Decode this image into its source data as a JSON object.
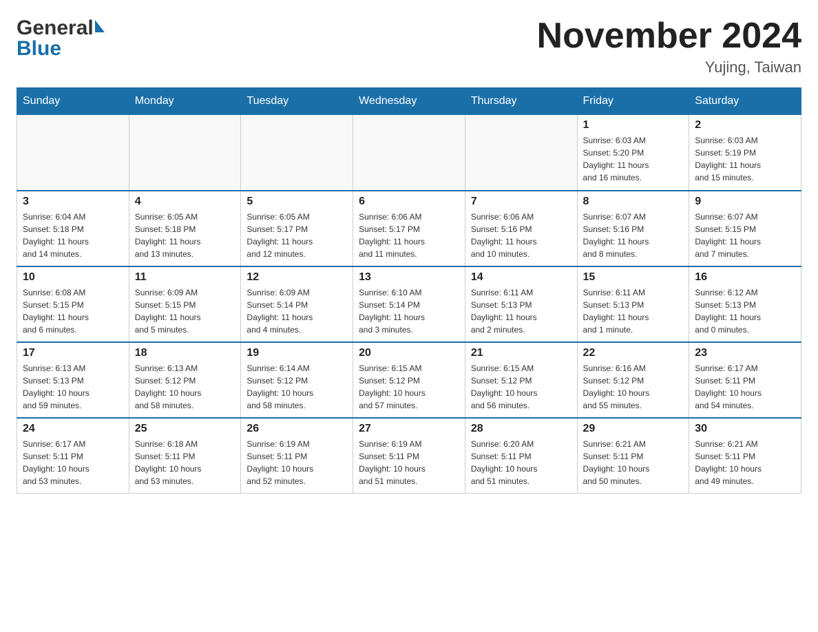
{
  "header": {
    "logo_general": "General",
    "logo_blue": "Blue",
    "month_title": "November 2024",
    "location": "Yujing, Taiwan"
  },
  "weekdays": [
    "Sunday",
    "Monday",
    "Tuesday",
    "Wednesday",
    "Thursday",
    "Friday",
    "Saturday"
  ],
  "rows": [
    [
      {
        "day": "",
        "info": ""
      },
      {
        "day": "",
        "info": ""
      },
      {
        "day": "",
        "info": ""
      },
      {
        "day": "",
        "info": ""
      },
      {
        "day": "",
        "info": ""
      },
      {
        "day": "1",
        "info": "Sunrise: 6:03 AM\nSunset: 5:20 PM\nDaylight: 11 hours\nand 16 minutes."
      },
      {
        "day": "2",
        "info": "Sunrise: 6:03 AM\nSunset: 5:19 PM\nDaylight: 11 hours\nand 15 minutes."
      }
    ],
    [
      {
        "day": "3",
        "info": "Sunrise: 6:04 AM\nSunset: 5:18 PM\nDaylight: 11 hours\nand 14 minutes."
      },
      {
        "day": "4",
        "info": "Sunrise: 6:05 AM\nSunset: 5:18 PM\nDaylight: 11 hours\nand 13 minutes."
      },
      {
        "day": "5",
        "info": "Sunrise: 6:05 AM\nSunset: 5:17 PM\nDaylight: 11 hours\nand 12 minutes."
      },
      {
        "day": "6",
        "info": "Sunrise: 6:06 AM\nSunset: 5:17 PM\nDaylight: 11 hours\nand 11 minutes."
      },
      {
        "day": "7",
        "info": "Sunrise: 6:06 AM\nSunset: 5:16 PM\nDaylight: 11 hours\nand 10 minutes."
      },
      {
        "day": "8",
        "info": "Sunrise: 6:07 AM\nSunset: 5:16 PM\nDaylight: 11 hours\nand 8 minutes."
      },
      {
        "day": "9",
        "info": "Sunrise: 6:07 AM\nSunset: 5:15 PM\nDaylight: 11 hours\nand 7 minutes."
      }
    ],
    [
      {
        "day": "10",
        "info": "Sunrise: 6:08 AM\nSunset: 5:15 PM\nDaylight: 11 hours\nand 6 minutes."
      },
      {
        "day": "11",
        "info": "Sunrise: 6:09 AM\nSunset: 5:15 PM\nDaylight: 11 hours\nand 5 minutes."
      },
      {
        "day": "12",
        "info": "Sunrise: 6:09 AM\nSunset: 5:14 PM\nDaylight: 11 hours\nand 4 minutes."
      },
      {
        "day": "13",
        "info": "Sunrise: 6:10 AM\nSunset: 5:14 PM\nDaylight: 11 hours\nand 3 minutes."
      },
      {
        "day": "14",
        "info": "Sunrise: 6:11 AM\nSunset: 5:13 PM\nDaylight: 11 hours\nand 2 minutes."
      },
      {
        "day": "15",
        "info": "Sunrise: 6:11 AM\nSunset: 5:13 PM\nDaylight: 11 hours\nand 1 minute."
      },
      {
        "day": "16",
        "info": "Sunrise: 6:12 AM\nSunset: 5:13 PM\nDaylight: 11 hours\nand 0 minutes."
      }
    ],
    [
      {
        "day": "17",
        "info": "Sunrise: 6:13 AM\nSunset: 5:13 PM\nDaylight: 10 hours\nand 59 minutes."
      },
      {
        "day": "18",
        "info": "Sunrise: 6:13 AM\nSunset: 5:12 PM\nDaylight: 10 hours\nand 58 minutes."
      },
      {
        "day": "19",
        "info": "Sunrise: 6:14 AM\nSunset: 5:12 PM\nDaylight: 10 hours\nand 58 minutes."
      },
      {
        "day": "20",
        "info": "Sunrise: 6:15 AM\nSunset: 5:12 PM\nDaylight: 10 hours\nand 57 minutes."
      },
      {
        "day": "21",
        "info": "Sunrise: 6:15 AM\nSunset: 5:12 PM\nDaylight: 10 hours\nand 56 minutes."
      },
      {
        "day": "22",
        "info": "Sunrise: 6:16 AM\nSunset: 5:12 PM\nDaylight: 10 hours\nand 55 minutes."
      },
      {
        "day": "23",
        "info": "Sunrise: 6:17 AM\nSunset: 5:11 PM\nDaylight: 10 hours\nand 54 minutes."
      }
    ],
    [
      {
        "day": "24",
        "info": "Sunrise: 6:17 AM\nSunset: 5:11 PM\nDaylight: 10 hours\nand 53 minutes."
      },
      {
        "day": "25",
        "info": "Sunrise: 6:18 AM\nSunset: 5:11 PM\nDaylight: 10 hours\nand 53 minutes."
      },
      {
        "day": "26",
        "info": "Sunrise: 6:19 AM\nSunset: 5:11 PM\nDaylight: 10 hours\nand 52 minutes."
      },
      {
        "day": "27",
        "info": "Sunrise: 6:19 AM\nSunset: 5:11 PM\nDaylight: 10 hours\nand 51 minutes."
      },
      {
        "day": "28",
        "info": "Sunrise: 6:20 AM\nSunset: 5:11 PM\nDaylight: 10 hours\nand 51 minutes."
      },
      {
        "day": "29",
        "info": "Sunrise: 6:21 AM\nSunset: 5:11 PM\nDaylight: 10 hours\nand 50 minutes."
      },
      {
        "day": "30",
        "info": "Sunrise: 6:21 AM\nSunset: 5:11 PM\nDaylight: 10 hours\nand 49 minutes."
      }
    ]
  ]
}
